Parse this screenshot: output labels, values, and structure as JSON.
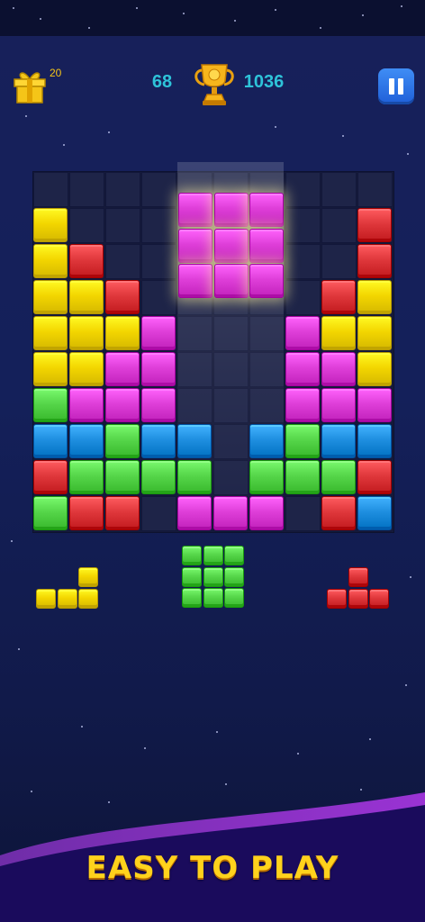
{
  "header": {
    "gift_count": "20",
    "score": "68",
    "best_score": "1036"
  },
  "colors": {
    "yellow": "#f3d600",
    "red": "#e0383c",
    "magenta": "#df3fd9",
    "green": "#56d64a",
    "blue": "#1f8fe0",
    "empty": "#1e2448"
  },
  "board": {
    "size": 10,
    "rows": [
      "..........",
      "Y........R",
      "YR.......R",
      "YYR.....RY",
      "YYYM...MYY",
      "YYMM...MMY",
      "GMMM...MMM",
      "BBGBB.BGBB",
      "RGGGG.GGGR",
      "GRR.MMM.RB"
    ]
  },
  "dragging_piece": {
    "color": "magenta",
    "cells": [
      [
        0,
        0
      ],
      [
        0,
        1
      ],
      [
        0,
        2
      ],
      [
        1,
        0
      ],
      [
        1,
        1
      ],
      [
        1,
        2
      ],
      [
        2,
        0
      ],
      [
        2,
        1
      ],
      [
        2,
        2
      ]
    ]
  },
  "tray_pieces": [
    {
      "color": "yellow",
      "cells": [
        [
          0,
          2
        ],
        [
          1,
          0
        ],
        [
          1,
          1
        ],
        [
          1,
          2
        ]
      ]
    },
    {
      "color": "green",
      "cells": [
        [
          0,
          0
        ],
        [
          0,
          1
        ],
        [
          0,
          2
        ],
        [
          1,
          0
        ],
        [
          1,
          1
        ],
        [
          1,
          2
        ],
        [
          2,
          0
        ],
        [
          2,
          1
        ],
        [
          2,
          2
        ]
      ]
    },
    {
      "color": "red",
      "cells": [
        [
          0,
          1
        ],
        [
          1,
          0
        ],
        [
          1,
          1
        ],
        [
          1,
          2
        ]
      ]
    }
  ],
  "tagline": "EASY TO PLAY"
}
